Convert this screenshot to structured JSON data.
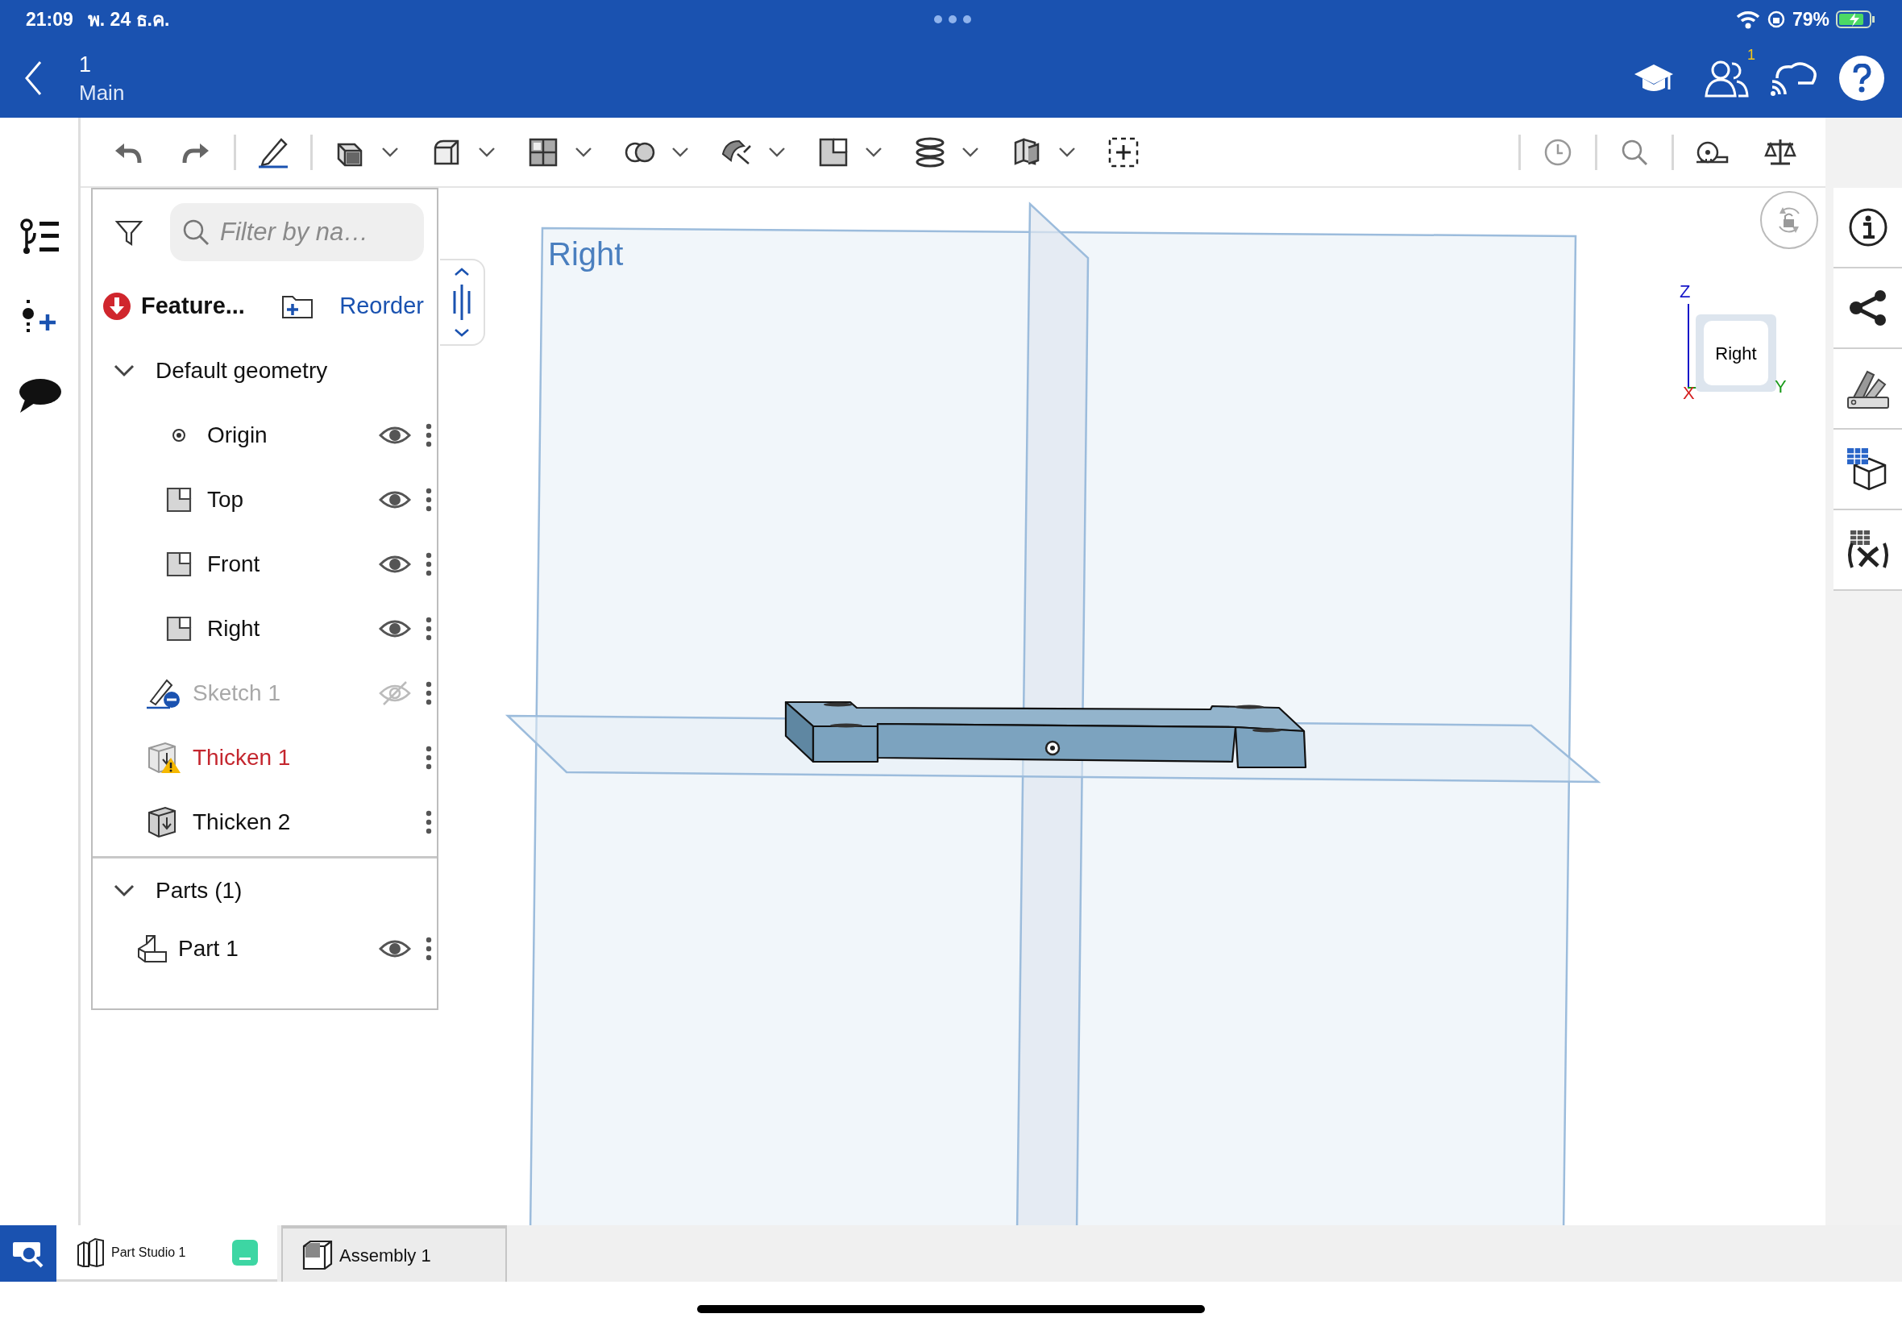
{
  "status_bar": {
    "time": "21:09",
    "date": "พ. 24 ธ.ค.",
    "battery": "79%"
  },
  "header": {
    "title": "1",
    "subtitle": "Main",
    "collaborator_badge": "1"
  },
  "feature_panel": {
    "filter": {
      "placeholder": "Filter by na…"
    },
    "list_label": "Feature...",
    "reorder_link": "Reorder",
    "tree": [
      {
        "label": "Default geometry",
        "expanded": true,
        "children": [
          {
            "label": "Origin",
            "kind": "origin",
            "visible": true,
            "error": false
          },
          {
            "label": "Top",
            "kind": "plane",
            "visible": true,
            "error": false
          },
          {
            "label": "Front",
            "kind": "plane",
            "visible": true,
            "error": false
          },
          {
            "label": "Right",
            "kind": "plane",
            "visible": true,
            "error": false
          },
          {
            "label": "Sketch 1",
            "kind": "sketch",
            "visible": false,
            "error": false
          },
          {
            "label": "Thicken 1",
            "kind": "thicken",
            "error": true
          },
          {
            "label": "Thicken 2",
            "kind": "thicken",
            "error": false
          }
        ]
      }
    ]
  },
  "parts": {
    "label": "Parts (1)",
    "expanded": true,
    "children": [
      {
        "label": "Part 1",
        "kind": "part",
        "visible": true
      }
    ]
  },
  "viewport": {
    "plane_label": "Right",
    "view_cube": {
      "face": "Right",
      "axes": [
        {
          "label": "Z",
          "color": "#1515c8"
        },
        {
          "label": "X",
          "color": "#d42020"
        },
        {
          "label": "Y",
          "color": "#1a9a1a"
        }
      ]
    }
  },
  "tabs": [
    {
      "label": "Part Studio 1",
      "kind": "part_studio",
      "selected": true
    },
    {
      "label": "Assembly 1",
      "kind": "assembly",
      "selected": false
    }
  ]
}
